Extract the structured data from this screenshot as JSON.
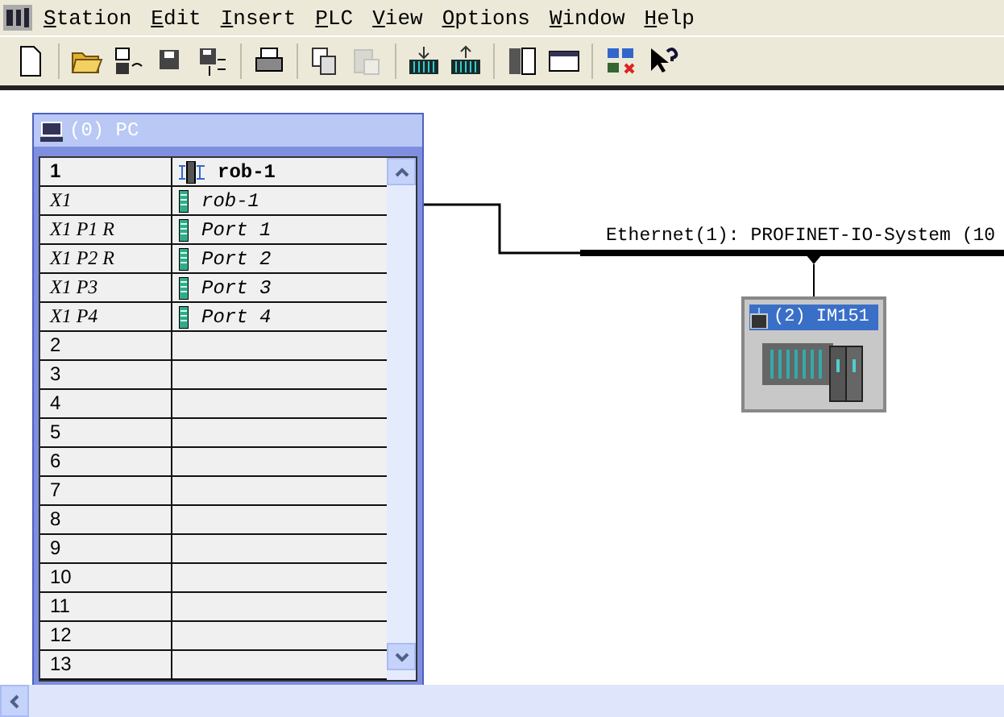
{
  "menu": [
    "Station",
    "Edit",
    "Insert",
    "PLC",
    "View",
    "Options",
    "Window",
    "Help"
  ],
  "toolbar": [
    {
      "kind": "new",
      "disabled": false
    },
    {
      "kind": "open",
      "disabled": false
    },
    {
      "kind": "accessible",
      "disabled": false
    },
    {
      "kind": "save",
      "disabled": false
    },
    {
      "kind": "compile",
      "disabled": false
    },
    {
      "kind": "print",
      "disabled": false
    },
    {
      "kind": "copy",
      "disabled": false
    },
    {
      "kind": "paste",
      "disabled": true
    },
    {
      "kind": "download",
      "disabled": false
    },
    {
      "kind": "upload",
      "disabled": false
    },
    {
      "kind": "rack",
      "disabled": false
    },
    {
      "kind": "catalog",
      "disabled": false
    },
    {
      "kind": "netpro",
      "disabled": false
    },
    {
      "kind": "help",
      "disabled": false
    }
  ],
  "station": {
    "title": "(0) PC",
    "rows": [
      {
        "slot": "1",
        "module": "rob-1",
        "kind": "module"
      },
      {
        "slot": "X1",
        "module": "rob-1",
        "kind": "interface"
      },
      {
        "slot": "X1 P1 R",
        "module": "Port 1",
        "kind": "port"
      },
      {
        "slot": "X1 P2 R",
        "module": "Port 2",
        "kind": "port"
      },
      {
        "slot": "X1 P3",
        "module": "Port 3",
        "kind": "port"
      },
      {
        "slot": "X1 P4",
        "module": "Port 4",
        "kind": "port"
      },
      {
        "slot": "2",
        "kind": "empty"
      },
      {
        "slot": "3",
        "kind": "empty"
      },
      {
        "slot": "4",
        "kind": "empty"
      },
      {
        "slot": "5",
        "kind": "empty"
      },
      {
        "slot": "6",
        "kind": "empty"
      },
      {
        "slot": "7",
        "kind": "empty"
      },
      {
        "slot": "8",
        "kind": "empty"
      },
      {
        "slot": "9",
        "kind": "empty"
      },
      {
        "slot": "10",
        "kind": "empty"
      },
      {
        "slot": "11",
        "kind": "empty"
      },
      {
        "slot": "12",
        "kind": "empty"
      },
      {
        "slot": "13",
        "kind": "empty"
      }
    ]
  },
  "network": {
    "label": "Ethernet(1): PROFINET-IO-System (10"
  },
  "device": {
    "title": "(2) IM151"
  }
}
